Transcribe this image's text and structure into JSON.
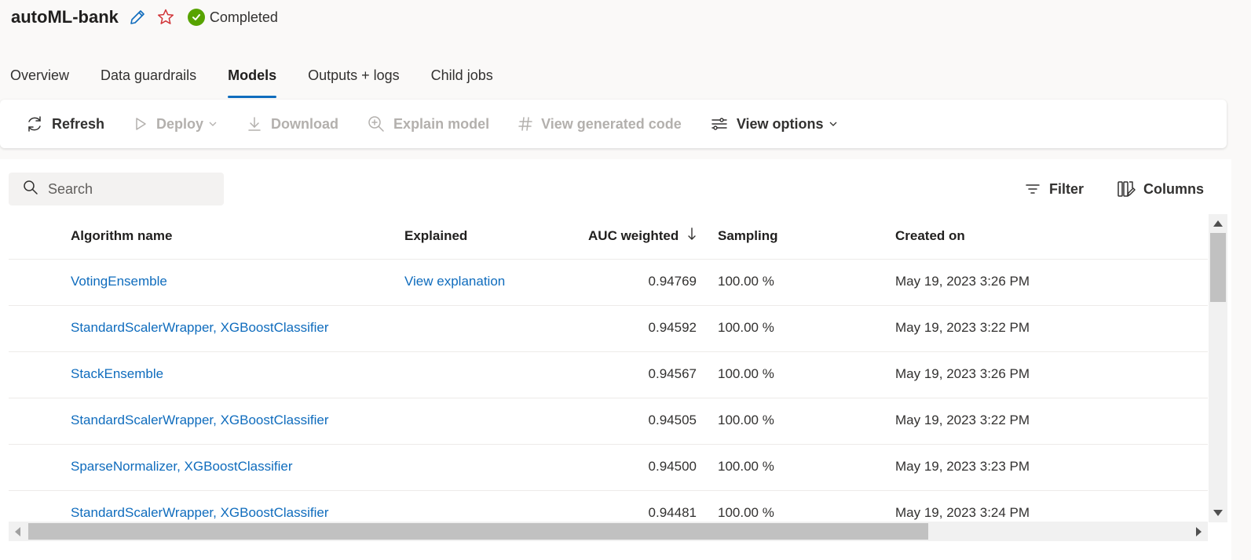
{
  "header": {
    "title": "autoML-bank",
    "status": "Completed",
    "icons": [
      "edit-pencil-icon",
      "favorite-star-icon",
      "status-check-icon"
    ],
    "colors": {
      "pencil": "#0f6cbd",
      "star": "#d13438",
      "status_ok": "#57a300"
    }
  },
  "tabs": [
    {
      "label": "Overview",
      "active": false
    },
    {
      "label": "Data guardrails",
      "active": false
    },
    {
      "label": "Models",
      "active": true
    },
    {
      "label": "Outputs + logs",
      "active": false
    },
    {
      "label": "Child jobs",
      "active": false
    }
  ],
  "toolbar": {
    "refresh": "Refresh",
    "deploy": "Deploy",
    "download": "Download",
    "explain": "Explain model",
    "view_code": "View generated code",
    "view_options": "View options"
  },
  "search": {
    "placeholder": "Search",
    "value": ""
  },
  "actions": {
    "filter": "Filter",
    "columns": "Columns"
  },
  "table": {
    "headers": {
      "algorithm": "Algorithm name",
      "explained": "Explained",
      "auc": "AUC weighted",
      "sampling": "Sampling",
      "created": "Created on"
    },
    "sort": {
      "column": "AUC weighted",
      "direction": "descending",
      "icon": "sort-down-arrow-icon"
    },
    "rows": [
      {
        "algorithm": "VotingEnsemble",
        "explained": "View explanation",
        "auc": "0.94769",
        "sampling": "100.00 %",
        "created": "May 19, 2023 3:26 PM"
      },
      {
        "algorithm": "StandardScalerWrapper, XGBoostClassifier",
        "explained": "",
        "auc": "0.94592",
        "sampling": "100.00 %",
        "created": "May 19, 2023 3:22 PM"
      },
      {
        "algorithm": "StackEnsemble",
        "explained": "",
        "auc": "0.94567",
        "sampling": "100.00 %",
        "created": "May 19, 2023 3:26 PM"
      },
      {
        "algorithm": "StandardScalerWrapper, XGBoostClassifier",
        "explained": "",
        "auc": "0.94505",
        "sampling": "100.00 %",
        "created": "May 19, 2023 3:22 PM"
      },
      {
        "algorithm": "SparseNormalizer, XGBoostClassifier",
        "explained": "",
        "auc": "0.94500",
        "sampling": "100.00 %",
        "created": "May 19, 2023 3:23 PM"
      },
      {
        "algorithm": "StandardScalerWrapper, XGBoostClassifier",
        "explained": "",
        "auc": "0.94481",
        "sampling": "100.00 %",
        "created": "May 19, 2023 3:24 PM"
      }
    ]
  }
}
